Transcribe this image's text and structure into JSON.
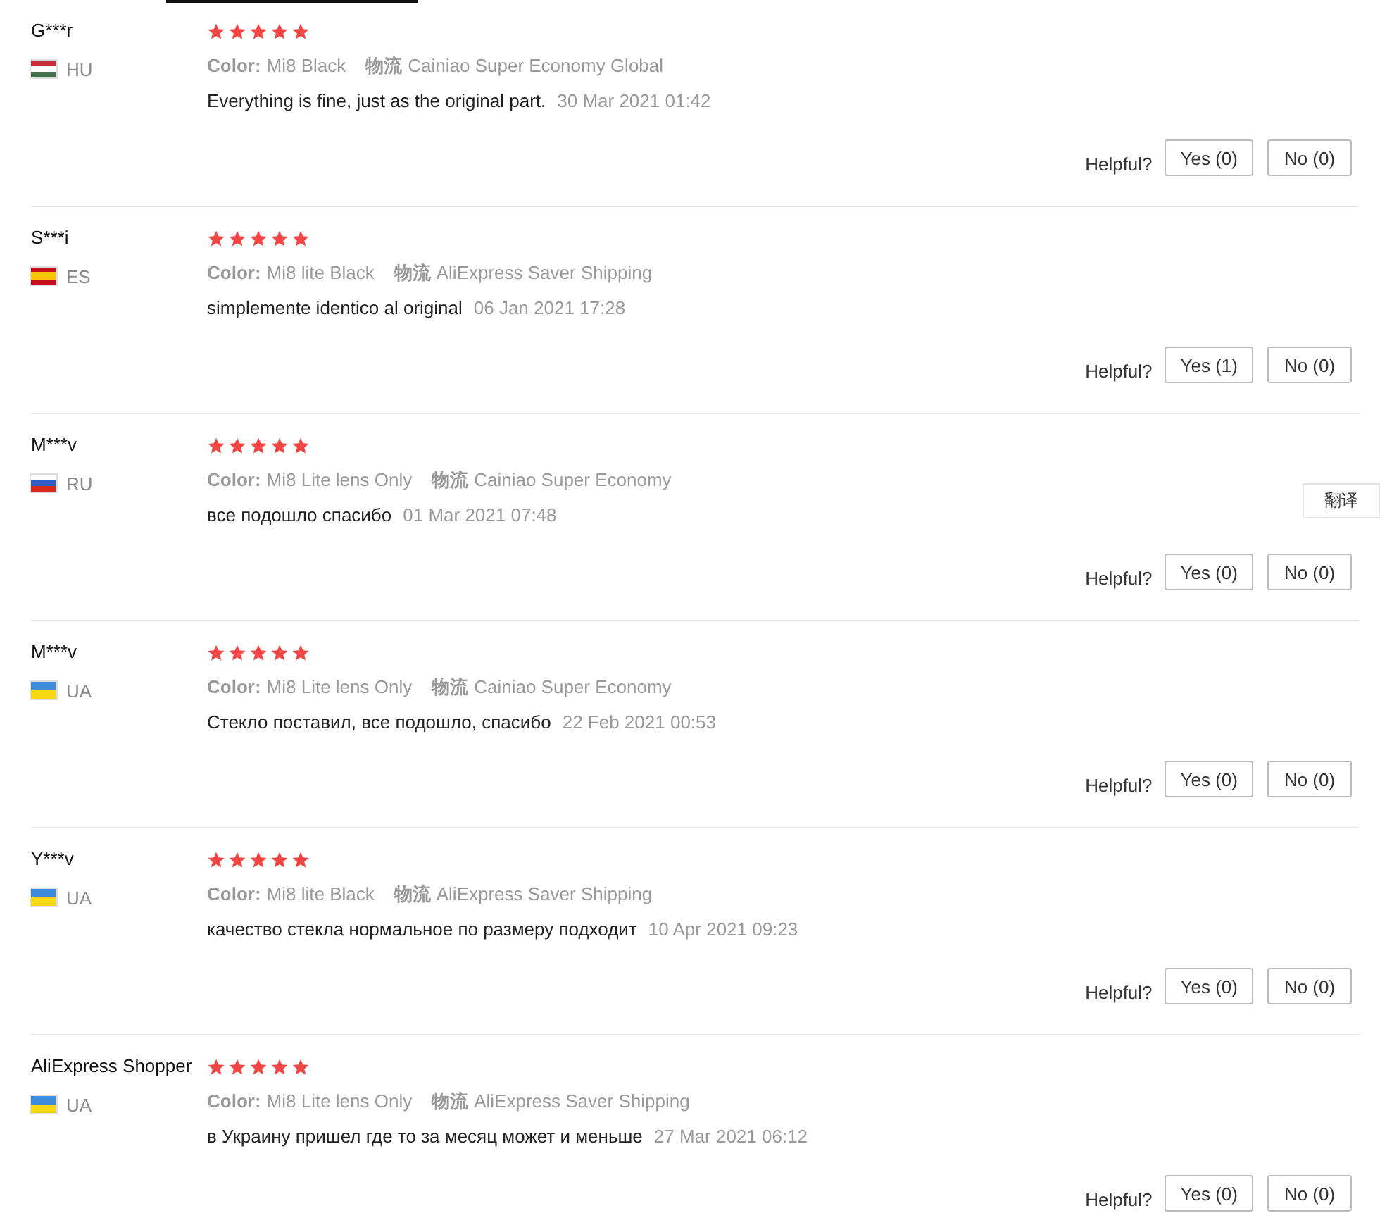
{
  "reviews": [
    {
      "name": "G***r",
      "country": "HU",
      "flag": [
        {
          "color": "#cd2a3e"
        },
        {
          "color": "#ffffff"
        },
        {
          "color": "#436f4d"
        }
      ],
      "stars": 5,
      "color_label": "Color:",
      "color_value": "Mi8 Black",
      "shipping_label": "物流",
      "shipping_value": "Cainiao Super Economy Global",
      "text": "Everything is fine, just as the original part.",
      "date": "30 Mar 2021 01:42",
      "helpful_label": "Helpful?",
      "yes": "Yes (0)",
      "no": "No (0)"
    },
    {
      "name": "S***i",
      "country": "ES",
      "flag": [
        {
          "color": "#c60b1e"
        },
        {
          "color": "#ffc400"
        },
        {
          "color": "#ffc400"
        },
        {
          "color": "#c60b1e"
        }
      ],
      "stars": 5,
      "color_label": "Color:",
      "color_value": "Mi8 lite Black",
      "shipping_label": "物流",
      "shipping_value": "AliExpress Saver Shipping",
      "text": "simplemente identico al original",
      "date": "06 Jan 2021 17:28",
      "helpful_label": "Helpful?",
      "yes": "Yes (1)",
      "no": "No (0)"
    },
    {
      "name": "M***v",
      "country": "RU",
      "flag": [
        {
          "color": "#ffffff"
        },
        {
          "color": "#2c5fbf"
        },
        {
          "color": "#d52b1e"
        }
      ],
      "stars": 5,
      "color_label": "Color:",
      "color_value": "Mi8 Lite lens Only",
      "shipping_label": "物流",
      "shipping_value": "Cainiao Super Economy",
      "text": "все подошло спасибо",
      "date": "01 Mar 2021 07:48",
      "helpful_label": "Helpful?",
      "yes": "Yes (0)",
      "no": "No (0)"
    },
    {
      "name": "M***v",
      "country": "UA",
      "flag": [
        {
          "color": "#3d8bd9"
        },
        {
          "color": "#f7d916"
        }
      ],
      "stars": 5,
      "color_label": "Color:",
      "color_value": "Mi8 Lite lens Only",
      "shipping_label": "物流",
      "shipping_value": "Cainiao Super Economy",
      "text": "Стекло поставил, все подошло, спасибо",
      "date": "22 Feb 2021 00:53",
      "helpful_label": "Helpful?",
      "yes": "Yes (0)",
      "no": "No (0)"
    },
    {
      "name": "Y***v",
      "country": "UA",
      "flag": [
        {
          "color": "#3d8bd9"
        },
        {
          "color": "#f7d916"
        }
      ],
      "stars": 5,
      "color_label": "Color:",
      "color_value": "Mi8 lite Black",
      "shipping_label": "物流",
      "shipping_value": "AliExpress Saver Shipping",
      "text": "качество стекла нормальное по размеру подходит",
      "date": "10 Apr 2021 09:23",
      "helpful_label": "Helpful?",
      "yes": "Yes (0)",
      "no": "No (0)"
    },
    {
      "name": "AliExpress Shopper",
      "country": "UA",
      "flag": [
        {
          "color": "#3d8bd9"
        },
        {
          "color": "#f7d916"
        }
      ],
      "stars": 5,
      "color_label": "Color:",
      "color_value": "Mi8 Lite lens Only",
      "shipping_label": "物流",
      "shipping_value": "AliExpress Saver Shipping",
      "text": "в Украину пришел где то за месяц может и меньше",
      "date": "27 Mar 2021 06:12",
      "helpful_label": "Helpful?",
      "yes": "Yes (0)",
      "no": "No (0)"
    }
  ],
  "translate_button": "翻译"
}
